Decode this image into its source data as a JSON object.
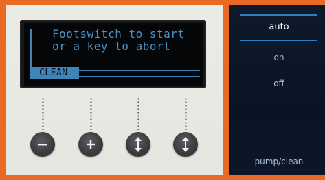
{
  "display": {
    "line1": "Footswitch to start",
    "line2": "or a key to abort",
    "status": "CLEAN"
  },
  "keys": [
    {
      "icon": "minus-icon",
      "label": "−"
    },
    {
      "icon": "plus-icon",
      "label": "+"
    },
    {
      "icon": "up-down-arrow-icon",
      "label": "↕"
    },
    {
      "icon": "up-down-arrow-icon",
      "label": "↕"
    }
  ],
  "menu": {
    "auto": "auto",
    "on": "on",
    "off": "off",
    "pump_clean": "pump/clean"
  },
  "colors": {
    "frame": "#e86a25",
    "lcd_text": "#4a92c6",
    "panel": "#0e1a2b",
    "accent": "#2f7dc4"
  }
}
